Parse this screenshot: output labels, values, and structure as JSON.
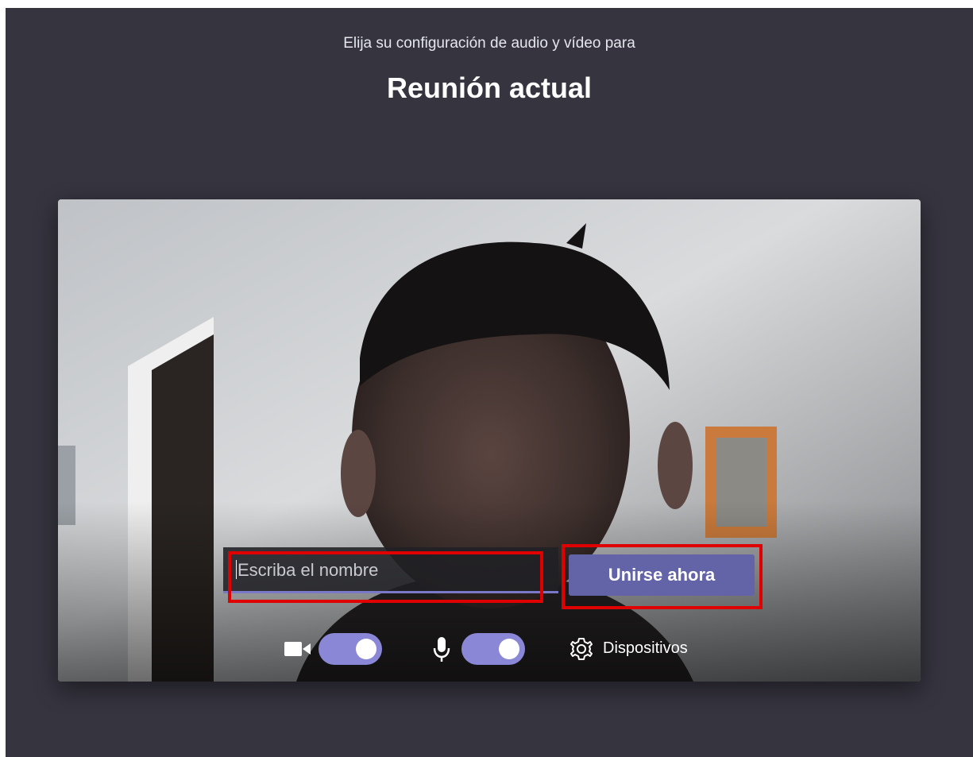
{
  "header": {
    "subtitle": "Elija su configuración de audio y vídeo para",
    "title": "Reunión actual"
  },
  "join": {
    "name_placeholder": "Escriba el nombre",
    "join_label": "Unirse ahora"
  },
  "controls": {
    "camera": {
      "icon": "video-camera-icon",
      "on": true
    },
    "microphone": {
      "icon": "microphone-icon",
      "on": true
    },
    "devices": {
      "icon": "gear-icon",
      "label": "Dispositivos"
    }
  },
  "colors": {
    "background": "#35343f",
    "accent": "#6264a7",
    "toggle_on": "#8a88d6",
    "highlight": "#e00000"
  }
}
